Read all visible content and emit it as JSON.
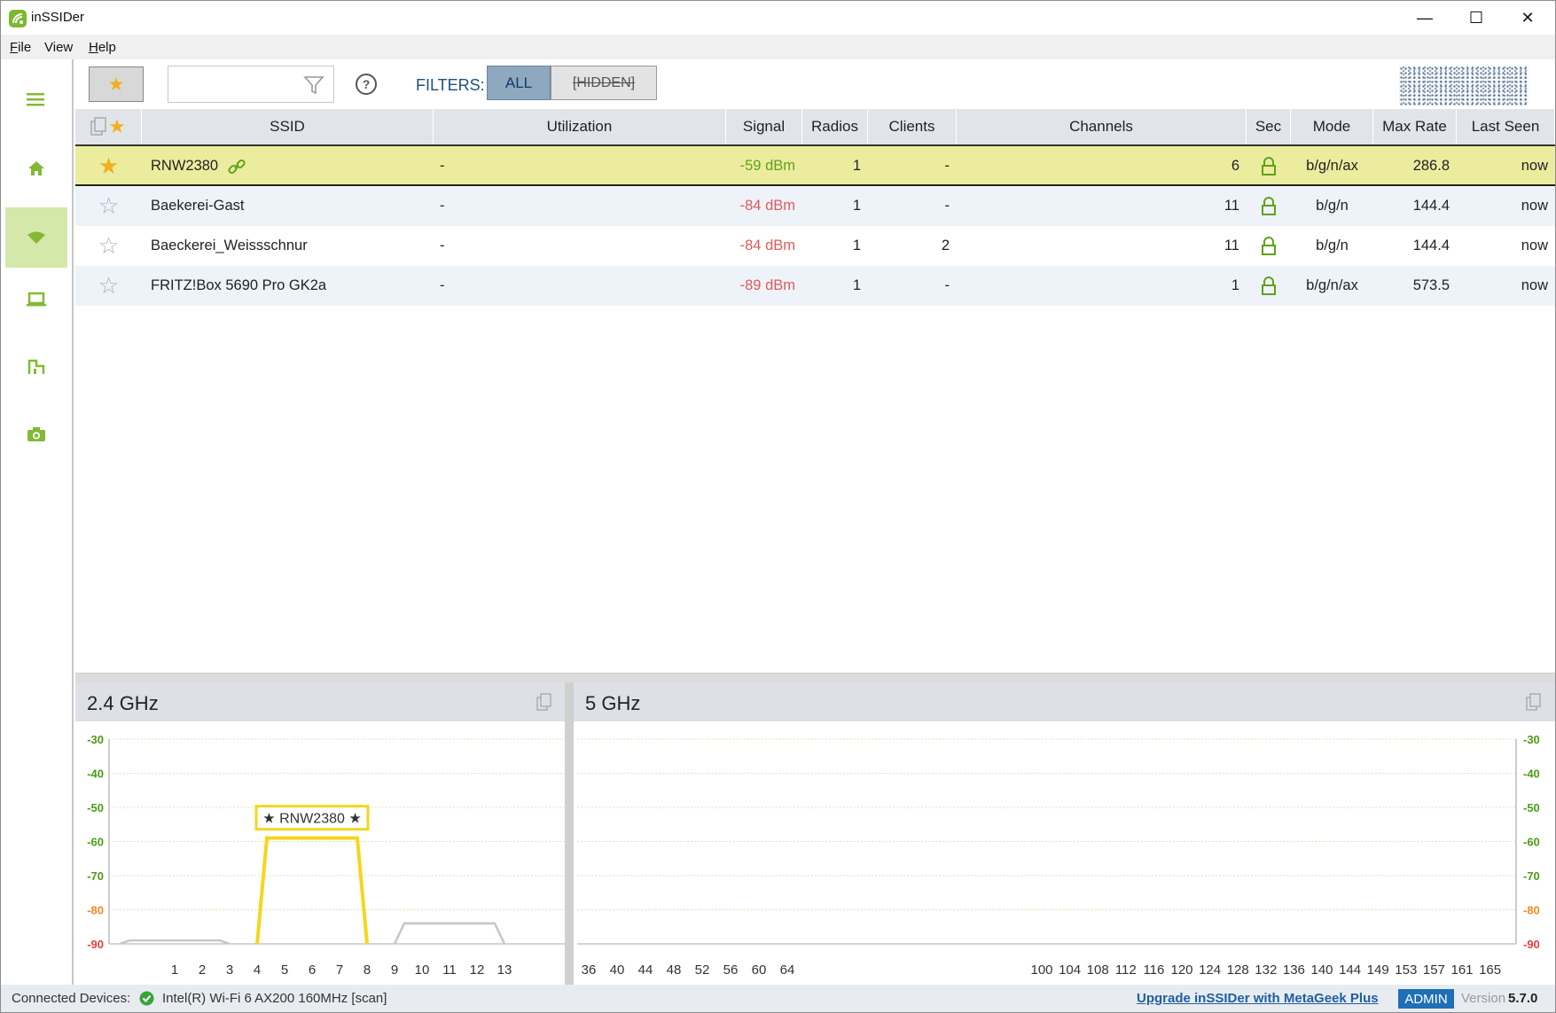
{
  "window": {
    "title": "inSSIDer",
    "minimize_glyph": "—",
    "maximize_glyph": "☐",
    "close_glyph": "✕"
  },
  "menu": {
    "items": [
      {
        "label": "File",
        "underline": "F"
      },
      {
        "label": "View",
        "underline": ""
      },
      {
        "label": "Help",
        "underline": "H"
      }
    ]
  },
  "sidebar": {
    "items": [
      {
        "name": "menu-icon"
      },
      {
        "name": "home-icon"
      },
      {
        "name": "wifi-icon",
        "active": true
      },
      {
        "name": "laptop-icon"
      },
      {
        "name": "floorplan-icon"
      },
      {
        "name": "camera-icon"
      }
    ]
  },
  "toolbar": {
    "favorites_icon": "star-icon",
    "search_placeholder": "",
    "search_value": "",
    "help_label": "?",
    "filters_label": "FILTERS:",
    "filter_all_label": "ALL",
    "filter_hidden_label": "[HIDDEN]"
  },
  "table": {
    "columns": [
      "",
      "SSID",
      "Utilization",
      "Signal",
      "Radios",
      "Clients",
      "Channels",
      "Sec",
      "Mode",
      "Max Rate",
      "Last Seen"
    ],
    "rows": [
      {
        "starred": true,
        "ssid": "RNW2380",
        "linked": true,
        "utilization": "-",
        "signal": "-59 dBm",
        "signal_quality": "good",
        "radios": "1",
        "clients": "-",
        "channels": "6",
        "secured": true,
        "mode": "b/g/n/ax",
        "max_rate": "286.8",
        "last_seen": "now"
      },
      {
        "starred": false,
        "ssid": "Baekerei-Gast",
        "linked": false,
        "utilization": "-",
        "signal": "-84 dBm",
        "signal_quality": "bad",
        "radios": "1",
        "clients": "-",
        "channels": "11",
        "secured": true,
        "mode": "b/g/n",
        "max_rate": "144.4",
        "last_seen": "now"
      },
      {
        "starred": false,
        "ssid": "Baeckerei_Weissschnur",
        "linked": false,
        "utilization": "-",
        "signal": "-84 dBm",
        "signal_quality": "bad",
        "radios": "1",
        "clients": "2",
        "channels": "11",
        "secured": true,
        "mode": "b/g/n",
        "max_rate": "144.4",
        "last_seen": "now"
      },
      {
        "starred": false,
        "ssid": "FRITZ!Box 5690 Pro GK2a",
        "linked": false,
        "utilization": "-",
        "signal": "-89 dBm",
        "signal_quality": "bad",
        "radios": "1",
        "clients": "-",
        "channels": "1",
        "secured": true,
        "mode": "b/g/n/ax",
        "max_rate": "573.5",
        "last_seen": "now"
      }
    ]
  },
  "chart_data": [
    {
      "type": "area",
      "title": "2.4 GHz",
      "ylim": [
        -90,
        -30
      ],
      "yticks": [
        "-30",
        "-40",
        "-50",
        "-60",
        "-70",
        "-80",
        "-90"
      ],
      "xticks": [
        "1",
        "2",
        "3",
        "4",
        "5",
        "6",
        "7",
        "8",
        "9",
        "10",
        "11",
        "12",
        "13"
      ],
      "networks": [
        {
          "ssid": "RNW2380",
          "label": "★ RNW2380 ★",
          "channel": 6,
          "signal": -59,
          "highlight": true,
          "color": "#f7d51d"
        },
        {
          "ssid": "Baekerei-Gast",
          "channel": 11,
          "signal": -84,
          "highlight": false,
          "color": "#c8c8c8"
        },
        {
          "ssid": "Baeckerei_Weissschnur",
          "channel": 11,
          "signal": -84,
          "highlight": false,
          "color": "#c8c8c8"
        },
        {
          "ssid": "FRITZ!Box 5690 Pro GK2a",
          "channel": 1,
          "signal": -89,
          "highlight": false,
          "color": "#c8c8c8"
        }
      ]
    },
    {
      "type": "area",
      "title": "5 GHz",
      "ylim": [
        -90,
        -30
      ],
      "yticks": [
        "-30",
        "-40",
        "-50",
        "-60",
        "-70",
        "-80",
        "-90"
      ],
      "xticks_low": [
        "36",
        "40",
        "44",
        "48",
        "52",
        "56",
        "60",
        "64"
      ],
      "xticks_high": [
        "100",
        "104",
        "108",
        "112",
        "116",
        "120",
        "124",
        "128",
        "132",
        "136",
        "140",
        "144",
        "149",
        "153",
        "157",
        "161",
        "165"
      ],
      "networks": []
    }
  ],
  "status": {
    "connected_label": "Connected Devices:",
    "device": "Intel(R) Wi-Fi 6 AX200 160MHz [scan]",
    "upgrade_link": "Upgrade inSSIDer with MetaGeek Plus",
    "admin_badge": "ADMIN",
    "version_label": "Version",
    "version": "5.7.0"
  },
  "colors": {
    "accent_green": "#84b935",
    "selected_row": "#ecec9f",
    "alt_row": "#edf3f9",
    "signal_good": "#5fa21b",
    "signal_bad": "#e05a5a",
    "star": "#f2b01e",
    "admin": "#1f6fb4"
  }
}
